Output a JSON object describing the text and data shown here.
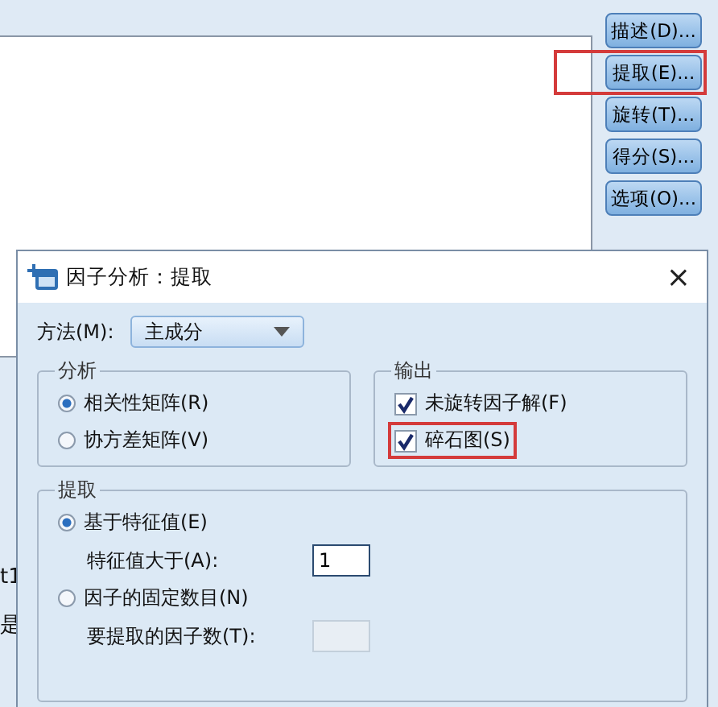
{
  "background_window": {
    "side_buttons": [
      {
        "label": "描述(D)...",
        "highlighted": false
      },
      {
        "label": "提取(E)...",
        "highlighted": true
      },
      {
        "label": "旋转(T)...",
        "highlighted": false
      },
      {
        "label": "得分(S)...",
        "highlighted": false
      },
      {
        "label": "选项(O)...",
        "highlighted": false
      }
    ],
    "left_fragments": [
      "t1",
      "是"
    ]
  },
  "dialog": {
    "title": "因子分析：提取",
    "close": "×",
    "method": {
      "label": "方法(M):",
      "value": "主成分"
    },
    "analysis": {
      "title": "分析",
      "options": [
        {
          "label": "相关性矩阵(R)",
          "selected": true
        },
        {
          "label": "协方差矩阵(V)",
          "selected": false
        }
      ]
    },
    "output": {
      "title": "输出",
      "options": [
        {
          "label": "未旋转因子解(F)",
          "checked": true,
          "highlighted": false
        },
        {
          "label": "碎石图(S)",
          "checked": true,
          "highlighted": true
        }
      ]
    },
    "extract": {
      "title": "提取",
      "options": [
        {
          "label": "基于特征值(E)",
          "selected": true,
          "field_label": "特征值大于(A):",
          "value": "1",
          "disabled": false
        },
        {
          "label": "因子的固定数目(N)",
          "selected": false,
          "field_label": "要提取的因子数(T):",
          "disabled": true
        }
      ]
    }
  }
}
